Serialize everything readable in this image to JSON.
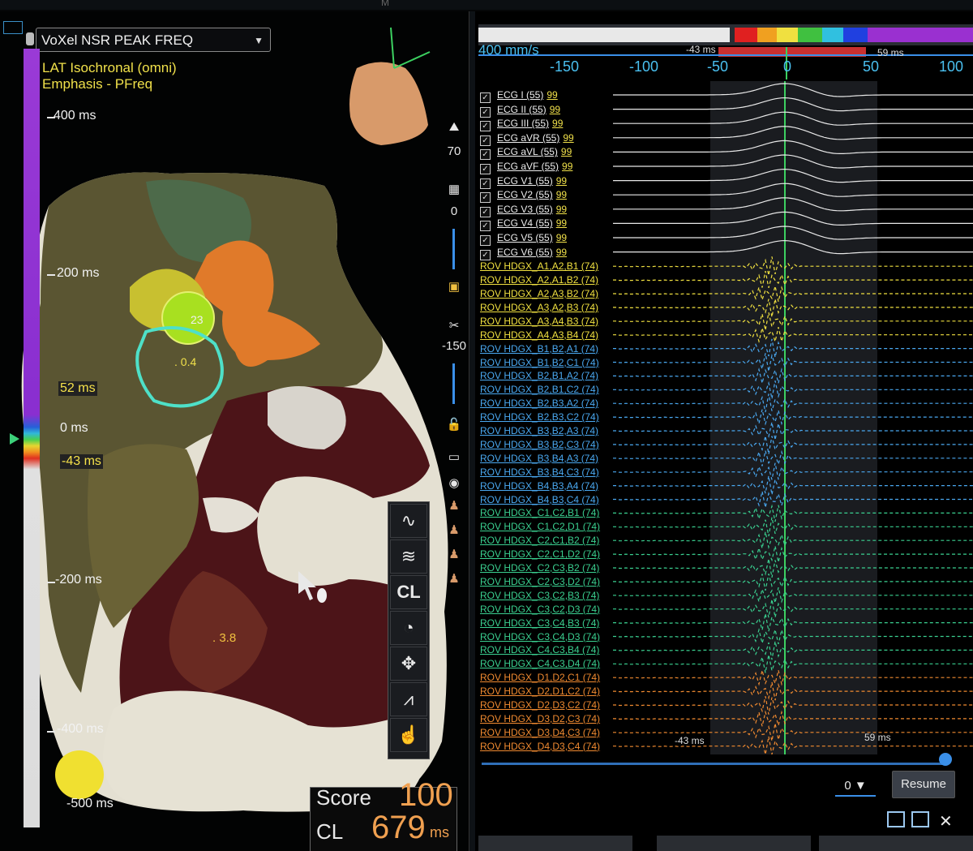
{
  "window": {
    "title_fragment": "M"
  },
  "map": {
    "selector_label": "VoXel NSR PEAK FREQ",
    "map_title_line1": "LAT Isochronal (omni)",
    "map_title_line2": "Emphasis - PFreq",
    "scale_ticks": [
      {
        "label": "400 ms"
      },
      {
        "label": "200 ms"
      },
      {
        "label": "52 ms"
      },
      {
        "label": "0 ms"
      },
      {
        "label": "-43 ms"
      },
      {
        "label": "-200 ms"
      },
      {
        "label": "-400 ms"
      },
      {
        "label": "-500 ms"
      }
    ],
    "annotations": {
      "point_23": "23",
      "point_04": ". 0.4",
      "point_38": ". 3.8"
    },
    "side_controls": {
      "peak_value": "70",
      "opacity_value": "0",
      "clip_value": "-150"
    },
    "tool_palette": [
      "waveform-tool",
      "signal-tool",
      "CL",
      "speedometer-tool",
      "move-tool",
      "noise-tool",
      "finger-tool"
    ],
    "score": {
      "label": "Score",
      "value": "100"
    },
    "cycle_length": {
      "label": "CL",
      "value": "679",
      "unit": "ms"
    }
  },
  "waveform": {
    "speed": "400 mm/s",
    "window_left": "-43 ms",
    "window_right": "59 ms",
    "ruler_labels": [
      "-150",
      "-100",
      "-50",
      "0",
      "50",
      "100"
    ],
    "ecg_channels": [
      {
        "name": "ECG I (55)",
        "value": "99"
      },
      {
        "name": "ECG II (55)",
        "value": "99"
      },
      {
        "name": "ECG III (55)",
        "value": "99"
      },
      {
        "name": "ECG aVR (55)",
        "value": "99"
      },
      {
        "name": "ECG aVL (55)",
        "value": "99"
      },
      {
        "name": "ECG aVF (55)",
        "value": "99"
      },
      {
        "name": "ECG V1 (55)",
        "value": "99"
      },
      {
        "name": "ECG V2 (55)",
        "value": "99"
      },
      {
        "name": "ECG V3 (55)",
        "value": "99"
      },
      {
        "name": "ECG V4 (55)",
        "value": "99"
      },
      {
        "name": "ECG V5 (55)",
        "value": "99"
      },
      {
        "name": "ECG V6 (55)",
        "value": "99"
      }
    ],
    "rov_channels": [
      {
        "name": "ROV HDGX_A1,A2,B1 (74)",
        "color": "#f0e040"
      },
      {
        "name": "ROV HDGX_A2,A1,B2 (74)",
        "color": "#f0e040"
      },
      {
        "name": "ROV HDGX_A2,A3,B2 (74)",
        "color": "#f0e040"
      },
      {
        "name": "ROV HDGX_A3,A2,B3 (74)",
        "color": "#f0e040"
      },
      {
        "name": "ROV HDGX_A3,A4,B3 (74)",
        "color": "#f0e040"
      },
      {
        "name": "ROV HDGX_A4,A3,B4 (74)",
        "color": "#f0e040"
      },
      {
        "name": "ROV HDGX_B1,B2,A1 (74)",
        "color": "#4aa8f0"
      },
      {
        "name": "ROV HDGX_B1,B2,C1 (74)",
        "color": "#4aa8f0"
      },
      {
        "name": "ROV HDGX_B2,B1,A2 (74)",
        "color": "#4aa8f0"
      },
      {
        "name": "ROV HDGX_B2,B1,C2 (74)",
        "color": "#4aa8f0"
      },
      {
        "name": "ROV HDGX_B2,B3,A2 (74)",
        "color": "#4aa8f0"
      },
      {
        "name": "ROV HDGX_B2,B3,C2 (74)",
        "color": "#4aa8f0"
      },
      {
        "name": "ROV HDGX_B3,B2,A3 (74)",
        "color": "#4aa8f0"
      },
      {
        "name": "ROV HDGX_B3,B2,C3 (74)",
        "color": "#4aa8f0"
      },
      {
        "name": "ROV HDGX_B3,B4,A3 (74)",
        "color": "#4aa8f0"
      },
      {
        "name": "ROV HDGX_B3,B4,C3 (74)",
        "color": "#4aa8f0"
      },
      {
        "name": "ROV HDGX_B4,B3,A4 (74)",
        "color": "#4aa8f0"
      },
      {
        "name": "ROV HDGX_B4,B3,C4 (74)",
        "color": "#4aa8f0"
      },
      {
        "name": "ROV HDGX_C1,C2,B1 (74)",
        "color": "#3ad090"
      },
      {
        "name": "ROV HDGX_C1,C2,D1 (74)",
        "color": "#3ad090"
      },
      {
        "name": "ROV HDGX_C2,C1,B2 (74)",
        "color": "#3ad090"
      },
      {
        "name": "ROV HDGX_C2,C1,D2 (74)",
        "color": "#3ad090"
      },
      {
        "name": "ROV HDGX_C2,C3,B2 (74)",
        "color": "#3ad090"
      },
      {
        "name": "ROV HDGX_C2,C3,D2 (74)",
        "color": "#3ad090"
      },
      {
        "name": "ROV HDGX_C3,C2,B3 (74)",
        "color": "#3ad090"
      },
      {
        "name": "ROV HDGX_C3,C2,D3 (74)",
        "color": "#3ad090"
      },
      {
        "name": "ROV HDGX_C3,C4,B3 (74)",
        "color": "#3ad090"
      },
      {
        "name": "ROV HDGX_C3,C4,D3 (74)",
        "color": "#3ad090"
      },
      {
        "name": "ROV HDGX_C4,C3,B4 (74)",
        "color": "#3ad090"
      },
      {
        "name": "ROV HDGX_C4,C3,D4 (74)",
        "color": "#3ad090"
      },
      {
        "name": "ROV HDGX_D1,D2,C1 (74)",
        "color": "#f08a30"
      },
      {
        "name": "ROV HDGX_D2,D1,C2 (74)",
        "color": "#f08a30"
      },
      {
        "name": "ROV HDGX_D2,D3,C2 (74)",
        "color": "#f08a30"
      },
      {
        "name": "ROV HDGX_D3,D2,C3 (74)",
        "color": "#f08a30"
      },
      {
        "name": "ROV HDGX_D3,D4,C3 (74)",
        "color": "#f08a30"
      },
      {
        "name": "ROV HDGX_D4,D3,C4 (74)",
        "color": "#f08a30"
      }
    ],
    "bottom_left_marker": "-43 ms",
    "bottom_right_marker": "59 ms",
    "playback_select": "0",
    "resume_label": "Resume"
  }
}
